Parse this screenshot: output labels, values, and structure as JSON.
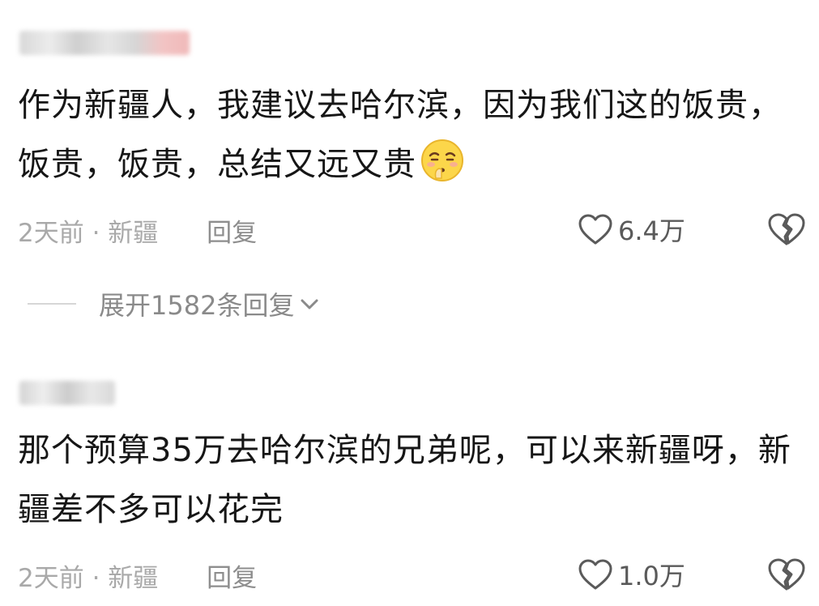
{
  "comments": [
    {
      "text": "作为新疆人，我建议去哈尔滨，因为我们这的饭贵，饭贵，饭贵，总结又远又贵",
      "emoji": "shushing-sad-face-emoji",
      "time": "2天前",
      "location": "· 新疆",
      "reply_label": "回复",
      "like_count": "6.4万",
      "expand_label": "展开1582条回复"
    },
    {
      "text": "那个预算35万去哈尔滨的兄弟呢，可以来新疆呀，新疆差不多可以花完",
      "time": "2天前",
      "location": "· 新疆",
      "reply_label": "回复",
      "like_count": "1.0万"
    }
  ],
  "icons": {
    "like": "heart-outline-icon",
    "dislike": "broken-heart-icon",
    "expand": "chevron-down-icon"
  },
  "colors": {
    "text": "#161616",
    "meta": "#a9a9a9",
    "icon": "#5a5a5a"
  }
}
